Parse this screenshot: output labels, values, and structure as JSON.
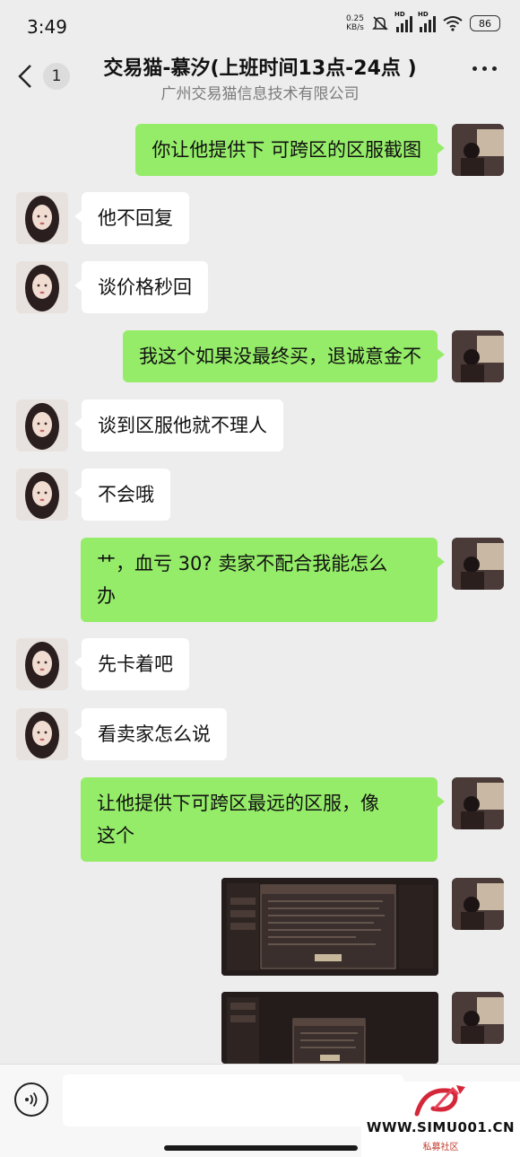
{
  "status_bar": {
    "time": "3:49",
    "net_speed_value": "0.25",
    "net_speed_unit": "KB/s",
    "hd1": "HD",
    "hd2": "HD",
    "battery": "86"
  },
  "header": {
    "unread_count": "1",
    "title": "交易猫-慕汐(上班时间13点-24点 )",
    "subtitle": "广州交易猫信息技术有限公司"
  },
  "messages": [
    {
      "side": "right",
      "text": "你让他提供下 可跨区的区服截图"
    },
    {
      "side": "left",
      "text": "他不回复"
    },
    {
      "side": "left",
      "text": "谈价格秒回"
    },
    {
      "side": "right",
      "text": "我这个如果没最终买，退诚意金不"
    },
    {
      "side": "left",
      "text": "谈到区服他就不理人"
    },
    {
      "side": "left",
      "text": "不会哦"
    },
    {
      "side": "right",
      "line1": "艹，血亏 30? 卖家不配合我能怎么",
      "line2": "办"
    },
    {
      "side": "left",
      "text": "先卡着吧"
    },
    {
      "side": "left",
      "text": "看卖家怎么说"
    },
    {
      "side": "right",
      "line1": "让他提供下可跨区最远的区服，像",
      "line2": "这个"
    },
    {
      "side": "right",
      "type": "image"
    },
    {
      "side": "right",
      "type": "image"
    }
  ],
  "watermark": {
    "url": "WWW.SIMU001.CN",
    "tag": "私募社区"
  },
  "colors": {
    "background": "#ededed",
    "self_bubble": "#95ec69",
    "other_bubble": "#ffffff"
  }
}
